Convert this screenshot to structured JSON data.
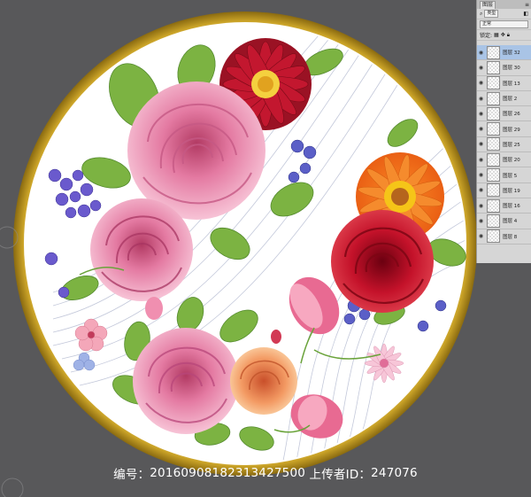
{
  "document": {
    "background_color": "#58585a",
    "frame_color": "#c9a227",
    "disc_color": "#ffffff",
    "line_color": "#b9bfd4"
  },
  "layers_panel": {
    "tab_label": "图层",
    "filter_label": "类型",
    "blend_mode": "正常",
    "lock_label": "锁定:",
    "layers": [
      {
        "name": "图层 32",
        "selected": true
      },
      {
        "name": "图层 30",
        "selected": false
      },
      {
        "name": "图层 13",
        "selected": false
      },
      {
        "name": "图层 2",
        "selected": false
      },
      {
        "name": "图层 26",
        "selected": false
      },
      {
        "name": "图层 29",
        "selected": false
      },
      {
        "name": "图层 25",
        "selected": false
      },
      {
        "name": "图层 20",
        "selected": false
      },
      {
        "name": "图层 5",
        "selected": false
      },
      {
        "name": "图层 19",
        "selected": false
      },
      {
        "name": "图层 16",
        "selected": false
      },
      {
        "name": "图层 4",
        "selected": false
      },
      {
        "name": "图层 8",
        "selected": false
      }
    ]
  },
  "footer": {
    "id_label": "编号：",
    "id_value": "20160908182313427500",
    "uploader_label": "上传者ID：",
    "uploader_value": "247076"
  }
}
